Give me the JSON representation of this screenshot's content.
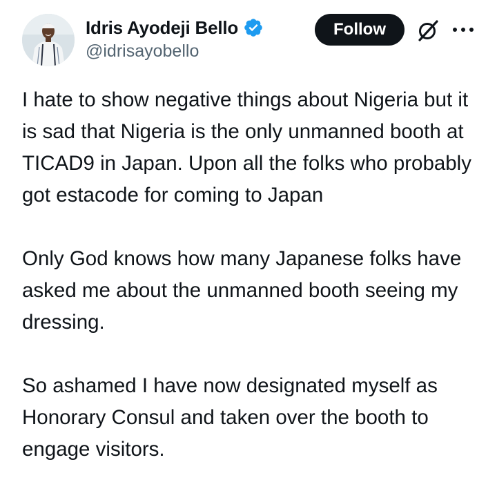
{
  "author": {
    "display_name": "Idris Ayodeji Bello",
    "handle": "@idrisayobello",
    "verified": true,
    "avatar_icon": "user-photo-avatar",
    "verified_icon": "verified-badge-icon",
    "verified_color": "#1d9bf0"
  },
  "actions": {
    "follow_label": "Follow",
    "grok_icon": "grok-icon",
    "more_icon": "more-options-icon"
  },
  "tweet": {
    "paragraphs": [
      "I hate to show negative things about Nigeria but it is sad that Nigeria is the only unmanned booth at TICAD9 in Japan. Upon all the folks who probably got estacode for coming to Japan",
      "Only God knows how many Japanese folks have asked me about the unmanned booth seeing my dressing.",
      "So ashamed I have now designated myself as Honorary Consul and taken over the booth to engage visitors."
    ]
  },
  "colors": {
    "text_primary": "#0f1419",
    "text_secondary": "#536471",
    "button_bg": "#0f1419",
    "button_text": "#ffffff",
    "background": "#ffffff"
  }
}
